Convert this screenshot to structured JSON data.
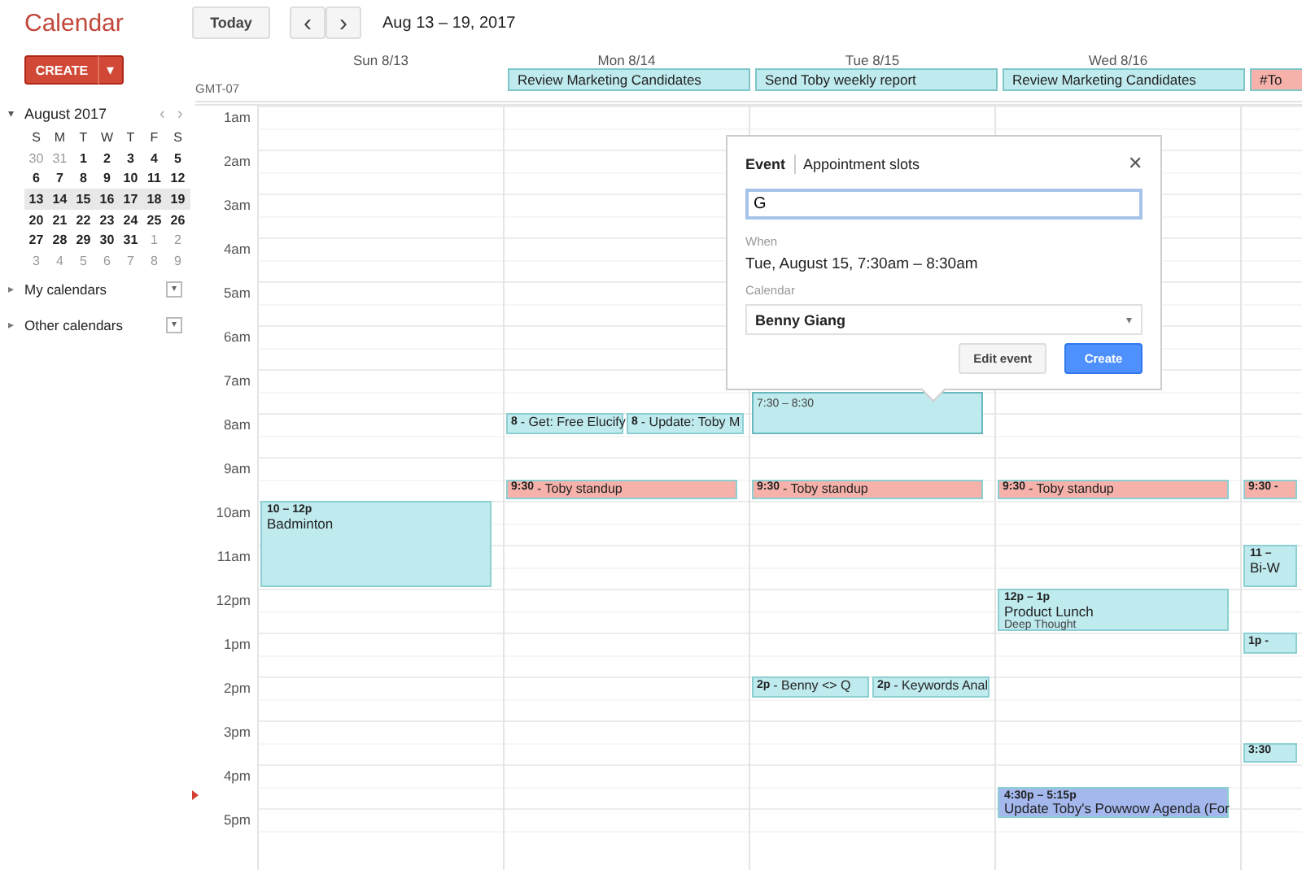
{
  "app_title": "Calendar",
  "toolbar": {
    "today": "Today",
    "prev": "‹",
    "next": "›",
    "range": "Aug 13 – 19, 2017"
  },
  "create_button": {
    "label": "CREATE",
    "caret": "▾"
  },
  "mini_calendar": {
    "expander": "▾",
    "title": "August 2017",
    "prev": "‹",
    "next": "›",
    "weekdays": [
      "S",
      "M",
      "T",
      "W",
      "T",
      "F",
      "S"
    ],
    "weeks": [
      {
        "selected": false,
        "days": [
          {
            "label": "30",
            "other_month": true
          },
          {
            "label": "31",
            "other_month": true
          },
          {
            "label": "1",
            "other_month": false
          },
          {
            "label": "2",
            "other_month": false
          },
          {
            "label": "3",
            "other_month": false
          },
          {
            "label": "4",
            "other_month": false
          },
          {
            "label": "5",
            "other_month": false
          }
        ]
      },
      {
        "selected": false,
        "days": [
          {
            "label": "6",
            "other_month": false
          },
          {
            "label": "7",
            "other_month": false
          },
          {
            "label": "8",
            "other_month": false
          },
          {
            "label": "9",
            "other_month": false
          },
          {
            "label": "10",
            "other_month": false
          },
          {
            "label": "11",
            "other_month": false
          },
          {
            "label": "12",
            "other_month": false
          }
        ]
      },
      {
        "selected": true,
        "days": [
          {
            "label": "13",
            "other_month": false
          },
          {
            "label": "14",
            "other_month": false
          },
          {
            "label": "15",
            "other_month": false
          },
          {
            "label": "16",
            "other_month": false
          },
          {
            "label": "17",
            "other_month": false
          },
          {
            "label": "18",
            "other_month": false
          },
          {
            "label": "19",
            "other_month": false
          }
        ]
      },
      {
        "selected": false,
        "days": [
          {
            "label": "20",
            "other_month": false
          },
          {
            "label": "21",
            "other_month": false
          },
          {
            "label": "22",
            "other_month": false
          },
          {
            "label": "23",
            "other_month": false
          },
          {
            "label": "24",
            "other_month": false
          },
          {
            "label": "25",
            "other_month": false
          },
          {
            "label": "26",
            "other_month": false
          }
        ]
      },
      {
        "selected": false,
        "days": [
          {
            "label": "27",
            "other_month": false
          },
          {
            "label": "28",
            "other_month": false
          },
          {
            "label": "29",
            "other_month": false
          },
          {
            "label": "30",
            "other_month": false
          },
          {
            "label": "31",
            "other_month": false
          },
          {
            "label": "1",
            "other_month": true
          },
          {
            "label": "2",
            "other_month": true
          }
        ]
      },
      {
        "selected": false,
        "days": [
          {
            "label": "3",
            "other_month": true
          },
          {
            "label": "4",
            "other_month": true
          },
          {
            "label": "5",
            "other_month": true
          },
          {
            "label": "6",
            "other_month": true
          },
          {
            "label": "7",
            "other_month": true
          },
          {
            "label": "8",
            "other_month": true
          },
          {
            "label": "9",
            "other_month": true
          }
        ]
      }
    ]
  },
  "calendar_sections": [
    {
      "expander": "▸",
      "label": "My calendars",
      "menu": "▾"
    },
    {
      "expander": "▸",
      "label": "Other calendars",
      "menu": "▾"
    }
  ],
  "timezone": "GMT-07",
  "hours": [
    "1am",
    "2am",
    "3am",
    "4am",
    "5am",
    "6am",
    "7am",
    "8am",
    "9am",
    "10am",
    "11am",
    "12pm",
    "1pm",
    "2pm",
    "3pm",
    "4pm",
    "5pm"
  ],
  "days": [
    {
      "header": "Sun 8/13",
      "events": [
        {
          "kind": "block",
          "time": "10 – 12p",
          "title": "Badminton",
          "color": "#bfeaee"
        }
      ]
    },
    {
      "header": "Mon 8/14",
      "all_day": [
        {
          "title": "Review Marketing Candidates",
          "color": "#bfeaee"
        }
      ],
      "events": [
        {
          "kind": "line",
          "time": "8",
          "title": "- Get: Free Elucify",
          "color": "#bfeaee"
        },
        {
          "kind": "line",
          "time": "8",
          "title": "- Update: Toby M",
          "color": "#bfeaee"
        },
        {
          "kind": "line",
          "time": "9:30",
          "title": "- Toby standup",
          "color": "#f6b2aa"
        }
      ]
    },
    {
      "header": "Tue 8/15",
      "all_day": [
        {
          "title": "Send Toby weekly report",
          "color": "#bfeaee"
        }
      ],
      "events": [
        {
          "kind": "draft",
          "time": "7:30 – 8:30",
          "color": "#bfeaee"
        },
        {
          "kind": "line",
          "time": "9:30",
          "title": "- Toby standup",
          "color": "#f6b2aa"
        },
        {
          "kind": "line",
          "time": "2p",
          "title": "- Benny <> Q",
          "color": "#bfeaee"
        },
        {
          "kind": "line",
          "time": "2p",
          "title": "- Keywords Anal",
          "color": "#bfeaee"
        }
      ]
    },
    {
      "header": "Wed 8/16",
      "all_day": [
        {
          "title": "Review Marketing Candidates",
          "color": "#bfeaee"
        }
      ],
      "events": [
        {
          "kind": "line",
          "time": "9:30",
          "title": "- Toby standup",
          "color": "#f6b2aa"
        },
        {
          "kind": "block",
          "time": "12p – 1p",
          "title": "Product Lunch",
          "location": "Deep Thought",
          "color": "#bfeaee"
        },
        {
          "kind": "block",
          "time": "4:30p – 5:15p",
          "title": "Update Toby's Powwow Agenda (For",
          "color": "#a4b8ee"
        }
      ]
    },
    {
      "all_day": [
        {
          "title": "#To",
          "color": "#f6b2aa"
        }
      ],
      "events": [
        {
          "kind": "line",
          "time": "9:30 -",
          "color": "#f6b2aa"
        },
        {
          "kind": "block",
          "time": "11 –",
          "title": "Bi-W",
          "color": "#bfeaee"
        },
        {
          "kind": "line",
          "time": "1p -",
          "color": "#bfeaee"
        },
        {
          "kind": "line",
          "time": "3:30",
          "color": "#bfeaee"
        }
      ]
    }
  ],
  "popup": {
    "tabs": [
      {
        "label": "Event",
        "selected": true
      },
      {
        "label": "Appointment slots",
        "selected": false
      }
    ],
    "close": "✕",
    "title_value": "G",
    "when_label": "When",
    "when": "Tue, August 15, 7:30am – 8:30am",
    "calendar_label": "Calendar",
    "calendar": "Benny Giang",
    "calendar_caret": "▾",
    "buttons": [
      {
        "label": "Edit event",
        "kind": "secondary"
      },
      {
        "label": "Create",
        "kind": "primary"
      }
    ]
  }
}
